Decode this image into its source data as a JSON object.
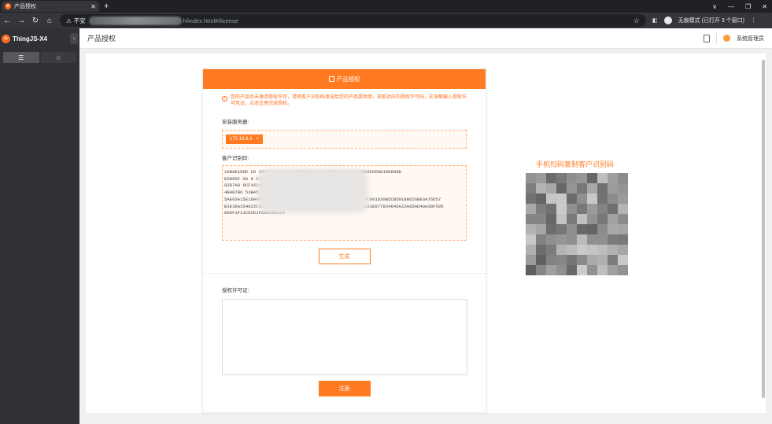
{
  "browser": {
    "tab_title": "产品授权",
    "new_tab": "+",
    "window_controls": [
      "∨",
      "—",
      "❐",
      "✕"
    ],
    "insecure_label": "不安",
    "url_visible": "h/index.html#/license",
    "profile_label": "无痕模式 (已打开 3 个窗口)"
  },
  "app": {
    "brand": "ThingJS-X4",
    "page_title": "产品授权",
    "user_name": "系统管理员"
  },
  "license": {
    "header": "产品授权",
    "notice": "您的产品尚未激活授权许可，请将客户识别码发送给您的产品提供商，获取对应的授权许可码，在该框输入授权许可凭证，点击注册完成授权。",
    "server_label": "安装服务器:",
    "server_ip": "172.16.8.3",
    "chip_close": "×",
    "client_label": "客户识别码:",
    "client_code_lines": [
      "16BAE10DE        C6              2667C6267AE390DEF8E632066C7D5E38F7A723C633FDD8810D689B",
      "ED995F               0A                       0                    FA3779F94D6865F59FA98CFA8DBE23FAD4",
      "83D7A8                                                             8CF16248F5E37BEBEB5EB5A13B026C3",
      "4B407B6                                                    53BA51F3F2A280F7F1E5C3B5D73DF7B05695",
      "5AE93A15E16A00EB991251C395D479D3087D3E8F3247B8D56E3074C891D30B5CB5918B626B83A76D57",
      "B1E36A354022C8E3E9158DE6907142E70B490A85CEC3AFF345F34931E077834845A23A85AD40A38F595",
      "066F1F11CECE1F686686004"
    ],
    "generate_button": "生成",
    "license_label": "授权许可证:",
    "license_value": "",
    "register_button": "注册"
  },
  "qr": {
    "title": "手机扫码复制客户识别码"
  },
  "colors": {
    "accent": "#ff7a20"
  }
}
